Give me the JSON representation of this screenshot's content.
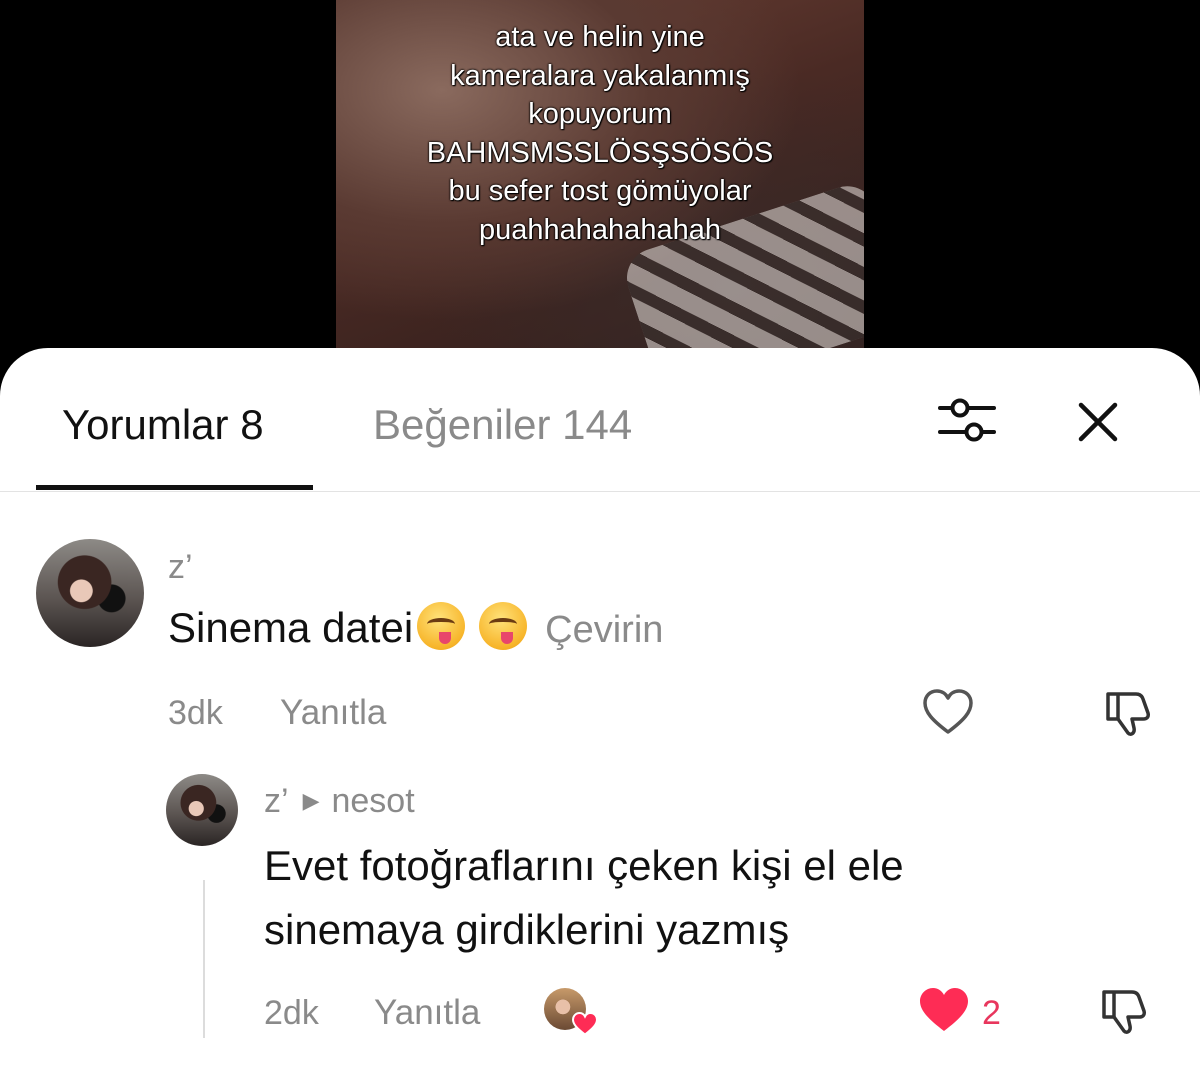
{
  "video": {
    "overlay_lines": [
      "ata ve helin yine",
      "kameralara yakalanmış",
      "kopuyorum",
      "BAHMSMSSLÖSŞSÖSÖS",
      "bu sefer tost gömüyolar",
      "puahhahahahahah"
    ]
  },
  "tabs": {
    "comments_label": "Yorumlar 8",
    "likes_label": "Beğeniler 144"
  },
  "icons": {
    "filter": "sliders-icon",
    "close": "close-icon",
    "like": "heart-icon",
    "dislike": "thumbs-down-icon"
  },
  "colors": {
    "like_active": "#fe2c55",
    "secondary_text": "#8a8a8a",
    "primary_text": "#111111"
  },
  "comments": [
    {
      "username": "z’",
      "text": "Sinema datei",
      "emoji": [
        "face-savoring-food",
        "face-savoring-food"
      ],
      "translate_label": "Çevirin",
      "time": "3dk",
      "reply_label": "Yanıtla",
      "liked": false
    }
  ],
  "reply": {
    "username": "z’",
    "reply_to": "nesot",
    "text_line1": "Evet fotoğraflarını çeken kişi el ele",
    "text_line2": "sinemaya girdiklerini yazmış",
    "time": "2dk",
    "reply_label": "Yanıtla",
    "liked": true,
    "like_count": "2"
  }
}
